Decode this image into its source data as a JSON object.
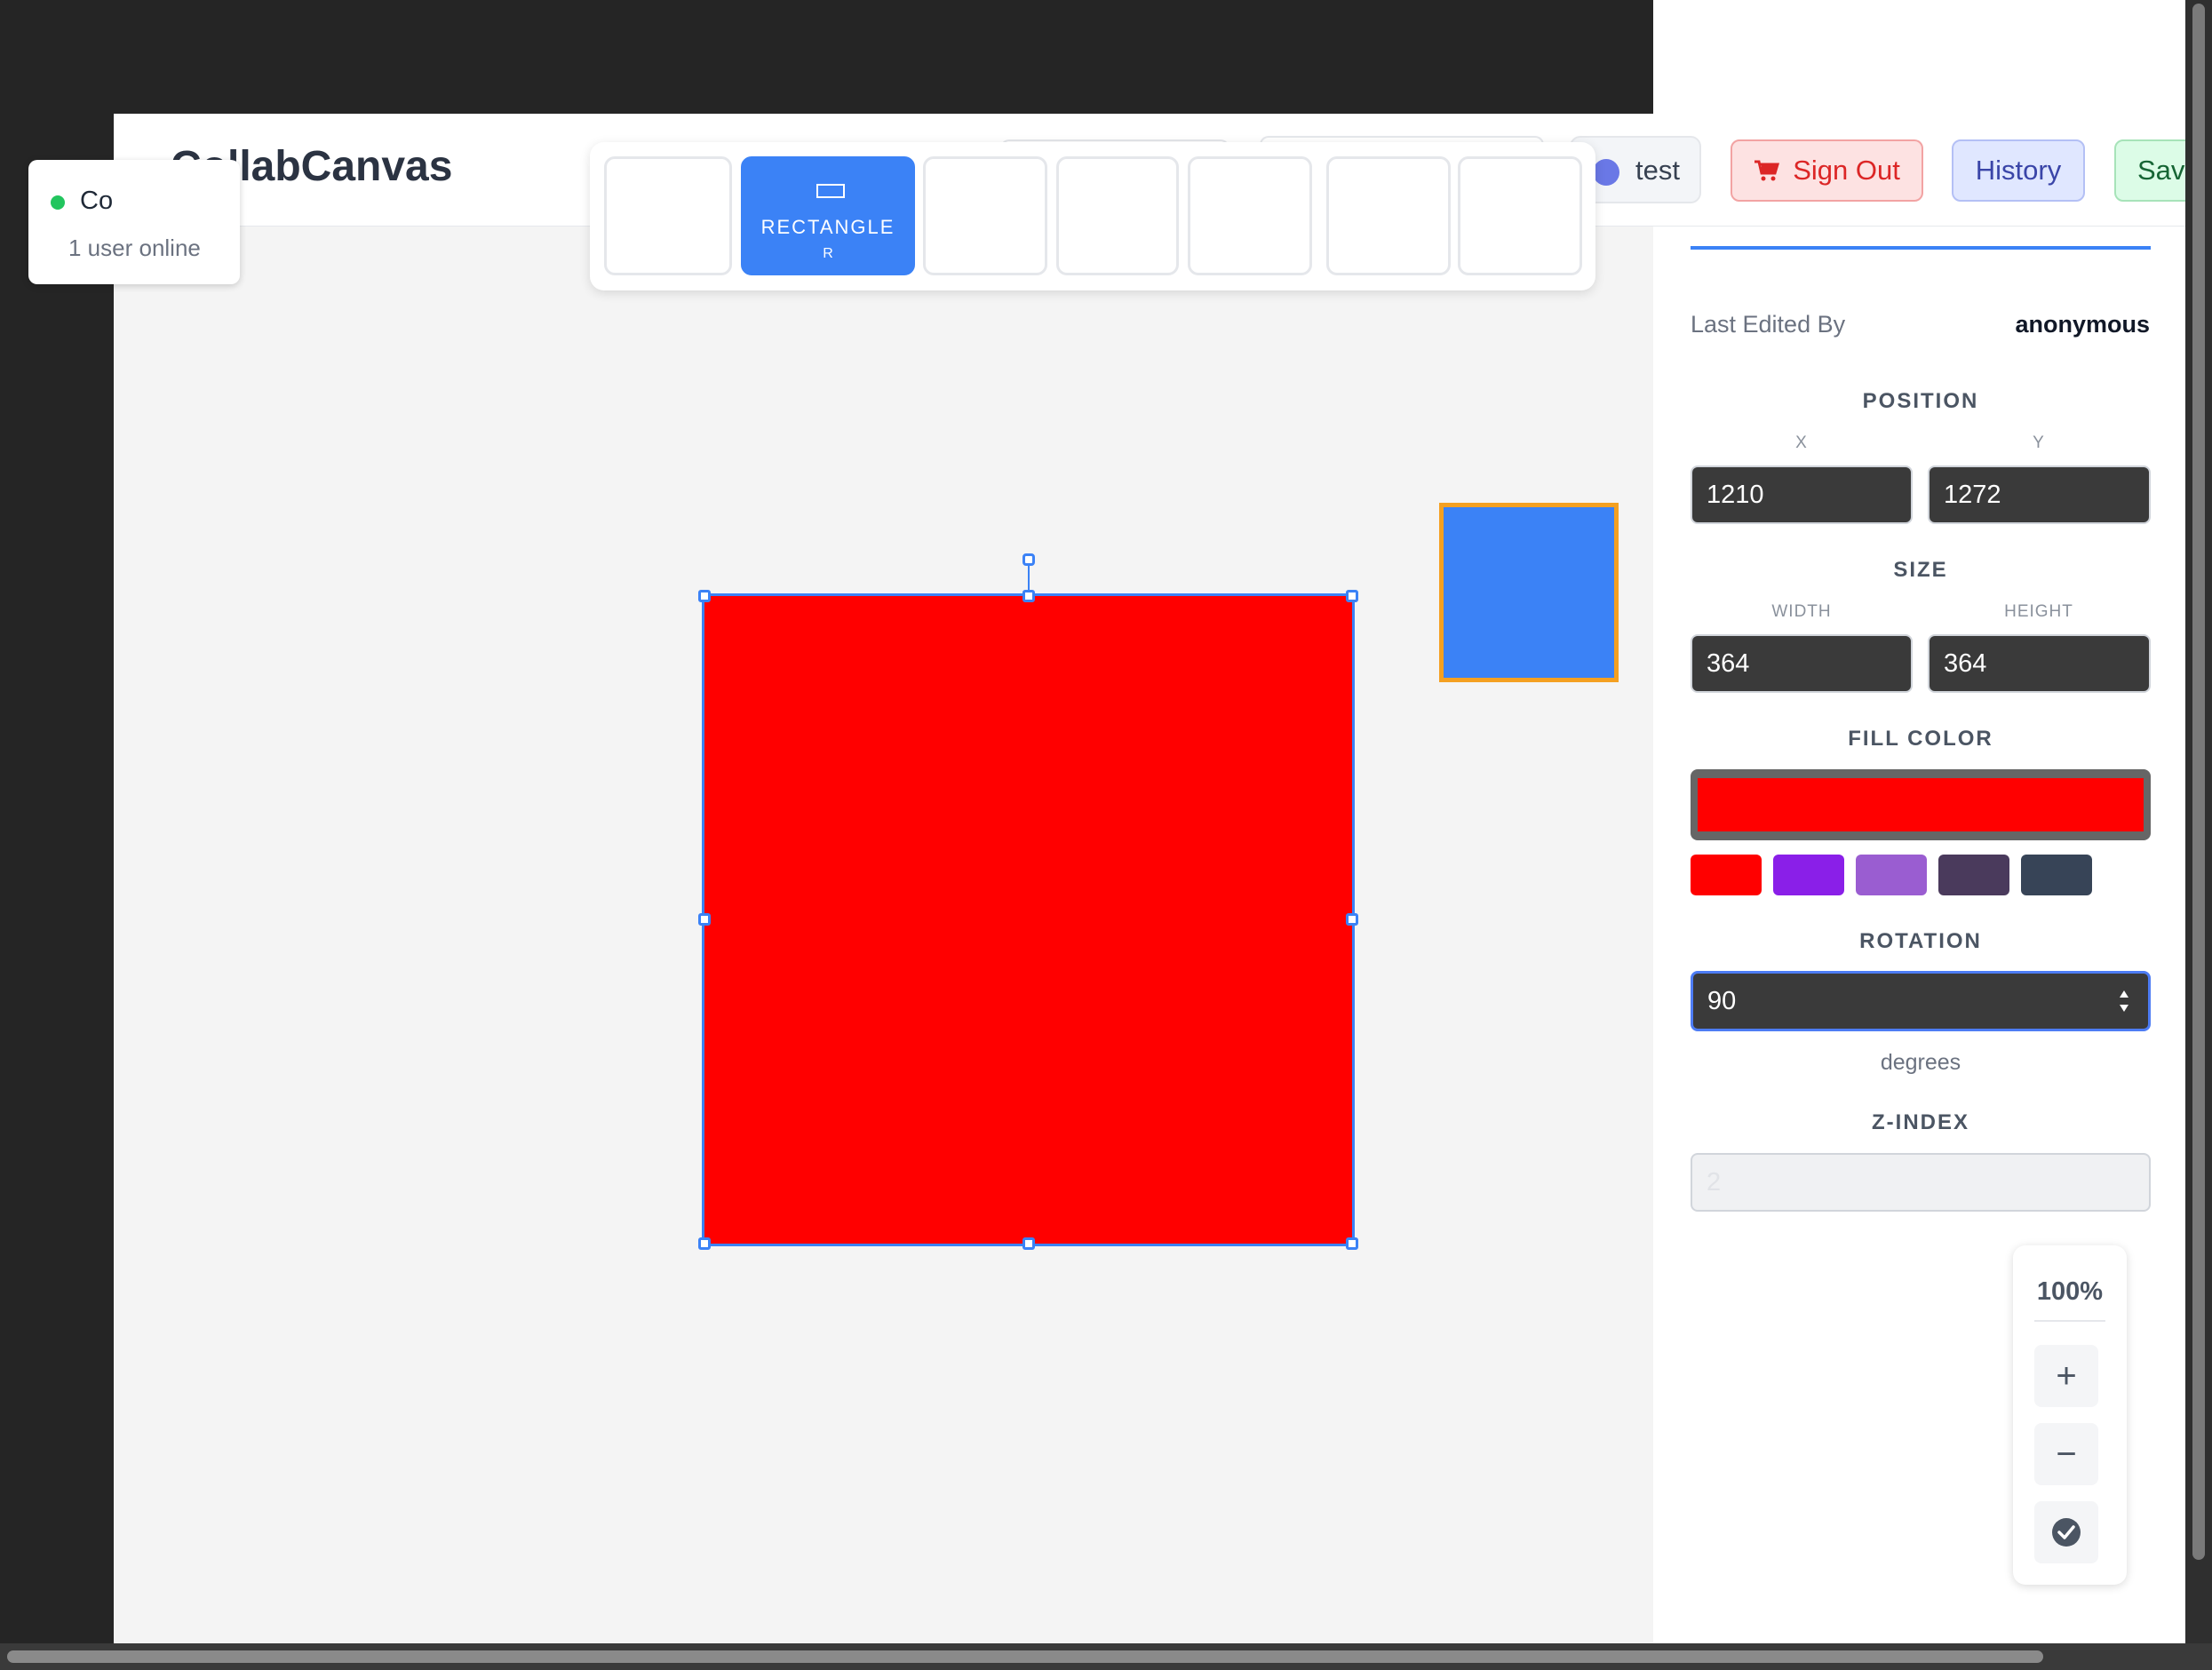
{
  "app": {
    "title": "CollabCanvas"
  },
  "presence": {
    "status": "Co",
    "online_text": "1 user online",
    "status_color": "#22c55e"
  },
  "header": {
    "user_name": "test",
    "user_color": "#6a78e6",
    "sign_out_label": "Sign Out",
    "history_label": "History",
    "save_label": "Save"
  },
  "toolbar": {
    "tools": [
      {
        "label": "",
        "key": "",
        "active": false
      },
      {
        "label": "RECTANGLE",
        "key": "R",
        "active": true
      },
      {
        "label": "",
        "key": "",
        "active": false
      },
      {
        "label": "",
        "key": "",
        "active": false
      },
      {
        "label": "",
        "key": "",
        "active": false
      },
      {
        "label": "",
        "key": "",
        "active": false
      },
      {
        "label": "",
        "key": "",
        "active": false
      }
    ],
    "active_color": "#3b82f6"
  },
  "canvas": {
    "shapes": [
      {
        "type": "rectangle",
        "fill": "#ff0000",
        "selected": true
      },
      {
        "type": "rectangle",
        "fill": "#3b82f6",
        "stroke": "#f4a021",
        "selected": false
      }
    ]
  },
  "properties": {
    "last_edited_label": "Last Edited By",
    "last_edited_value": "anonymous",
    "position": {
      "title": "POSITION",
      "x_label": "X",
      "y_label": "Y",
      "x": "1210",
      "y": "1272"
    },
    "size": {
      "title": "SIZE",
      "width_label": "WIDTH",
      "height_label": "HEIGHT",
      "width": "364",
      "height": "364"
    },
    "fill": {
      "title": "FILL COLOR",
      "current": "#ff0000",
      "swatches": [
        "#ff0000",
        "#8a1fe8",
        "#9a5dd1",
        "#4a3a5c",
        "#374457"
      ]
    },
    "rotation": {
      "title": "ROTATION",
      "value": "90",
      "unit": "degrees"
    },
    "zindex": {
      "title": "Z-INDEX",
      "value": "2"
    }
  },
  "zoom": {
    "level": "100%",
    "zoom_in": "+",
    "zoom_out": "−"
  }
}
